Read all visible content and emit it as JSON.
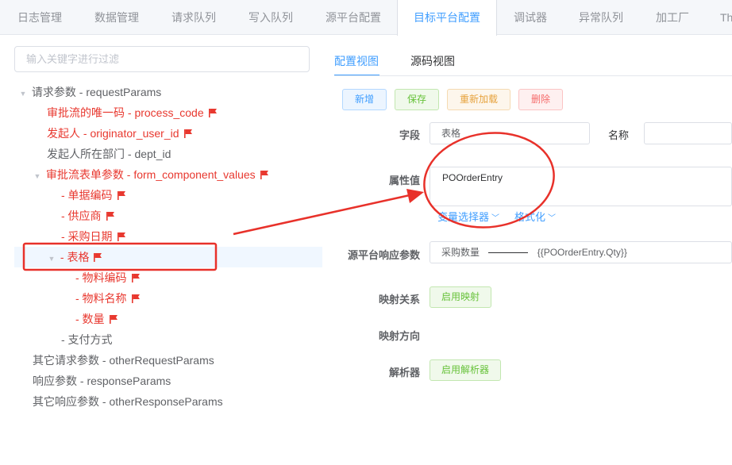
{
  "top_tabs": [
    {
      "label": "日志管理"
    },
    {
      "label": "数据管理"
    },
    {
      "label": "请求队列"
    },
    {
      "label": "写入队列"
    },
    {
      "label": "源平台配置"
    },
    {
      "label": "目标平台配置"
    },
    {
      "label": "调试器"
    },
    {
      "label": "异常队列"
    },
    {
      "label": "加工厂"
    },
    {
      "label": "Th"
    }
  ],
  "search": {
    "placeholder": "输入关键字进行过滤"
  },
  "tree": [
    {
      "label": "请求参数 - requestParams",
      "flag": false,
      "color": "dark"
    },
    {
      "label": "审批流的唯一码 - process_code",
      "flag": true,
      "color": "red"
    },
    {
      "label": "发起人 - originator_user_id",
      "flag": true,
      "color": "red"
    },
    {
      "label": "发起人所在部门 - dept_id",
      "flag": false,
      "color": "dark"
    },
    {
      "label": "审批流表单参数 - form_component_values",
      "flag": true,
      "color": "red"
    },
    {
      "label": "- 单据编码",
      "flag": true,
      "color": "red"
    },
    {
      "label": "- 供应商",
      "flag": true,
      "color": "red"
    },
    {
      "label": "- 采购日期",
      "flag": true,
      "color": "red"
    },
    {
      "label": "- 表格",
      "flag": true,
      "color": "red"
    },
    {
      "label": "- 物料编码",
      "flag": true,
      "color": "red"
    },
    {
      "label": "- 物料名称",
      "flag": true,
      "color": "red"
    },
    {
      "label": "- 数量",
      "flag": true,
      "color": "red"
    },
    {
      "label": "- 支付方式",
      "flag": false,
      "color": "dark"
    },
    {
      "label": "其它请求参数 - otherRequestParams",
      "flag": false,
      "color": "dark"
    },
    {
      "label": "响应参数 - responseParams",
      "flag": false,
      "color": "dark"
    },
    {
      "label": "其它响应参数 - otherResponseParams",
      "flag": false,
      "color": "dark"
    }
  ],
  "view_tabs": {
    "config": "配置视图",
    "source": "源码视图"
  },
  "toolbar": {
    "new": "新增",
    "save": "保存",
    "reload": "重新加载",
    "delete": "删除"
  },
  "form": {
    "field_label": "字段",
    "field_value": "表格",
    "name_label": "名称",
    "attr_label": "属性值",
    "attr_value": "POOrderEntry",
    "var_selector": "变量选择器",
    "format": "格式化",
    "source_resp_label": "源平台响应参数",
    "source_resp_key": "采购数量",
    "source_resp_value": "{{POOrderEntry.Qty}}",
    "mapping_label": "映射关系",
    "mapping_button": "启用映射",
    "mapping_dir_label": "映射方向",
    "parser_label": "解析器",
    "parser_button": "启用解析器"
  },
  "colors": {
    "accent": "#409eff",
    "flag_red": "#e8382f",
    "annotation_red": "#e8312a"
  }
}
